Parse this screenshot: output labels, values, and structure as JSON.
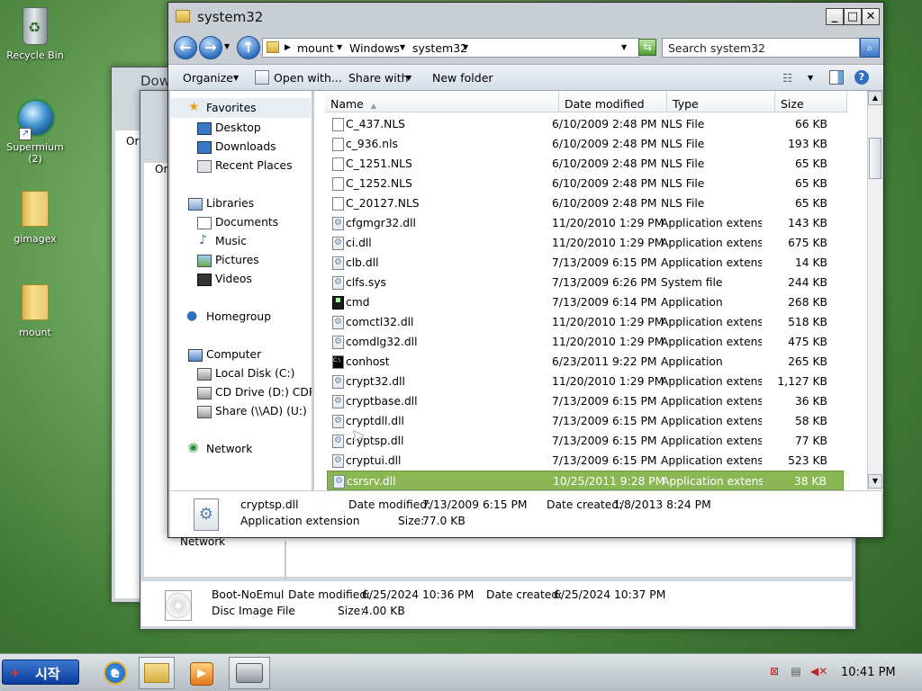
{
  "desktop": {
    "icons": [
      {
        "label": "Recycle Bin"
      },
      {
        "label": "Supermium (2)"
      },
      {
        "label": "gimagex"
      },
      {
        "label": "mount"
      }
    ]
  },
  "background_windows": {
    "title_partial": "Dow",
    "sidebar_partial_1": "Or",
    "sidebar_partial_2": "Or",
    "network_label": "Network",
    "details": {
      "name": "Boot-NoEmul",
      "type": "Disc Image File",
      "date_modified_label": "Date modified:",
      "date_modified": "6/25/2024 10:36 PM",
      "date_created_label": "Date created:",
      "date_created": "6/25/2024 10:37 PM",
      "size_label": "Size:",
      "size": "4.00 KB"
    }
  },
  "window": {
    "title": "system32",
    "controls": {
      "minimize": "_",
      "maximize": "□",
      "close": "✕"
    },
    "breadcrumb": [
      "mount",
      "Windows",
      "system32"
    ],
    "search_placeholder": "Search system32",
    "commands": {
      "organize": "Organize",
      "open_with": "Open with...",
      "share_with": "Share with",
      "new_folder": "New folder"
    },
    "nav": {
      "favorites": "Favorites",
      "desktop": "Desktop",
      "downloads": "Downloads",
      "recent": "Recent Places",
      "libraries": "Libraries",
      "documents": "Documents",
      "music": "Music",
      "pictures": "Pictures",
      "videos": "Videos",
      "homegroup": "Homegroup",
      "computer": "Computer",
      "local_disk": "Local Disk (C:)",
      "cd_drive": "CD Drive (D:) CDROM",
      "share": "Share (\\\\AD) (U:)",
      "network": "Network"
    },
    "columns": {
      "name": "Name",
      "date": "Date modified",
      "type": "Type",
      "size": "Size"
    },
    "files": [
      {
        "name": "C_437.NLS",
        "date": "6/10/2009 2:48 PM",
        "type": "NLS File",
        "size": "66 KB",
        "icon": "blank"
      },
      {
        "name": "c_936.nls",
        "date": "6/10/2009 2:48 PM",
        "type": "NLS File",
        "size": "193 KB",
        "icon": "blank"
      },
      {
        "name": "C_1251.NLS",
        "date": "6/10/2009 2:48 PM",
        "type": "NLS File",
        "size": "65 KB",
        "icon": "blank"
      },
      {
        "name": "C_1252.NLS",
        "date": "6/10/2009 2:48 PM",
        "type": "NLS File",
        "size": "65 KB",
        "icon": "blank"
      },
      {
        "name": "C_20127.NLS",
        "date": "6/10/2009 2:48 PM",
        "type": "NLS File",
        "size": "65 KB",
        "icon": "blank"
      },
      {
        "name": "cfgmgr32.dll",
        "date": "11/20/2010 1:29 PM",
        "type": "Application extens...",
        "size": "143 KB",
        "icon": "dll"
      },
      {
        "name": "ci.dll",
        "date": "11/20/2010 1:29 PM",
        "type": "Application extens...",
        "size": "675 KB",
        "icon": "dll"
      },
      {
        "name": "clb.dll",
        "date": "7/13/2009 6:15 PM",
        "type": "Application extens...",
        "size": "14 KB",
        "icon": "dll"
      },
      {
        "name": "clfs.sys",
        "date": "7/13/2009 6:26 PM",
        "type": "System file",
        "size": "244 KB",
        "icon": "dll"
      },
      {
        "name": "cmd",
        "date": "7/13/2009 6:14 PM",
        "type": "Application",
        "size": "268 KB",
        "icon": "app"
      },
      {
        "name": "comctl32.dll",
        "date": "11/20/2010 1:29 PM",
        "type": "Application extens...",
        "size": "518 KB",
        "icon": "dll"
      },
      {
        "name": "comdlg32.dll",
        "date": "11/20/2010 1:29 PM",
        "type": "Application extens...",
        "size": "475 KB",
        "icon": "dll"
      },
      {
        "name": "conhost",
        "date": "6/23/2011 9:22 PM",
        "type": "Application",
        "size": "265 KB",
        "icon": "cmdi"
      },
      {
        "name": "crypt32.dll",
        "date": "11/20/2010 1:29 PM",
        "type": "Application extens...",
        "size": "1,127 KB",
        "icon": "dll"
      },
      {
        "name": "cryptbase.dll",
        "date": "7/13/2009 6:15 PM",
        "type": "Application extens...",
        "size": "36 KB",
        "icon": "dll"
      },
      {
        "name": "cryptdll.dll",
        "date": "7/13/2009 6:15 PM",
        "type": "Application extens...",
        "size": "58 KB",
        "icon": "dll"
      },
      {
        "name": "cryptsp.dll",
        "date": "7/13/2009 6:15 PM",
        "type": "Application extens...",
        "size": "77 KB",
        "icon": "dll"
      },
      {
        "name": "cryptui.dll",
        "date": "7/13/2009 6:15 PM",
        "type": "Application extens...",
        "size": "523 KB",
        "icon": "dll"
      },
      {
        "name": "csrsrv.dll",
        "date": "10/25/2011 9:28 PM",
        "type": "Application extens...",
        "size": "38 KB",
        "icon": "dll",
        "selected": true
      }
    ],
    "details": {
      "name": "cryptsp.dll",
      "type": "Application extension",
      "date_modified_label": "Date modified:",
      "date_modified": "7/13/2009 6:15 PM",
      "date_created_label": "Date created:",
      "date_created": "1/8/2013 8:24 PM",
      "size_label": "Size:",
      "size": "77.0 KB"
    }
  },
  "taskbar": {
    "start_label": "시작",
    "clock": "10:41 PM"
  },
  "colors": {
    "selection": "#8bb656",
    "desktop": "#4f8a43"
  }
}
